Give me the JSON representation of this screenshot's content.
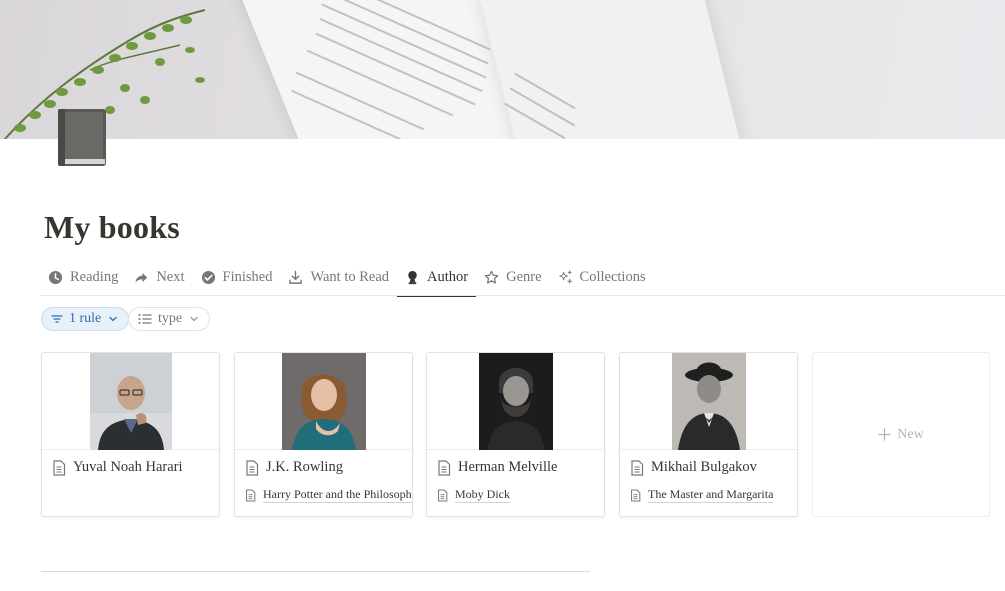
{
  "page": {
    "title": "My books",
    "cover_description": "open book with plant",
    "icon": "book-icon"
  },
  "tabs": [
    {
      "label": "Reading",
      "icon": "clock-icon",
      "active": false
    },
    {
      "label": "Next",
      "icon": "arrow-forward-icon",
      "active": false
    },
    {
      "label": "Finished",
      "icon": "check-circle-icon",
      "active": false
    },
    {
      "label": "Want to Read",
      "icon": "download-icon",
      "active": false
    },
    {
      "label": "Author",
      "icon": "person-bust-icon",
      "active": true
    },
    {
      "label": "Genre",
      "icon": "star-icon",
      "active": false
    },
    {
      "label": "Collections",
      "icon": "sparkle-icon",
      "active": false
    }
  ],
  "filters": {
    "rule_label": "1 rule",
    "sort_label": "type"
  },
  "cards": [
    {
      "name": "Yuval Noah Harari",
      "book": ""
    },
    {
      "name": "J.K. Rowling",
      "book": "Harry Potter and the Philosopher's Stone"
    },
    {
      "name": "Herman Melville",
      "book": "Moby Dick"
    },
    {
      "name": "Mikhail Bulgakov",
      "book": "The Master and Margarita"
    }
  ],
  "new_card": {
    "label": "New"
  },
  "colors": {
    "accent_blue": "#2f6fb5",
    "text": "#37352f",
    "muted": "#787774"
  }
}
